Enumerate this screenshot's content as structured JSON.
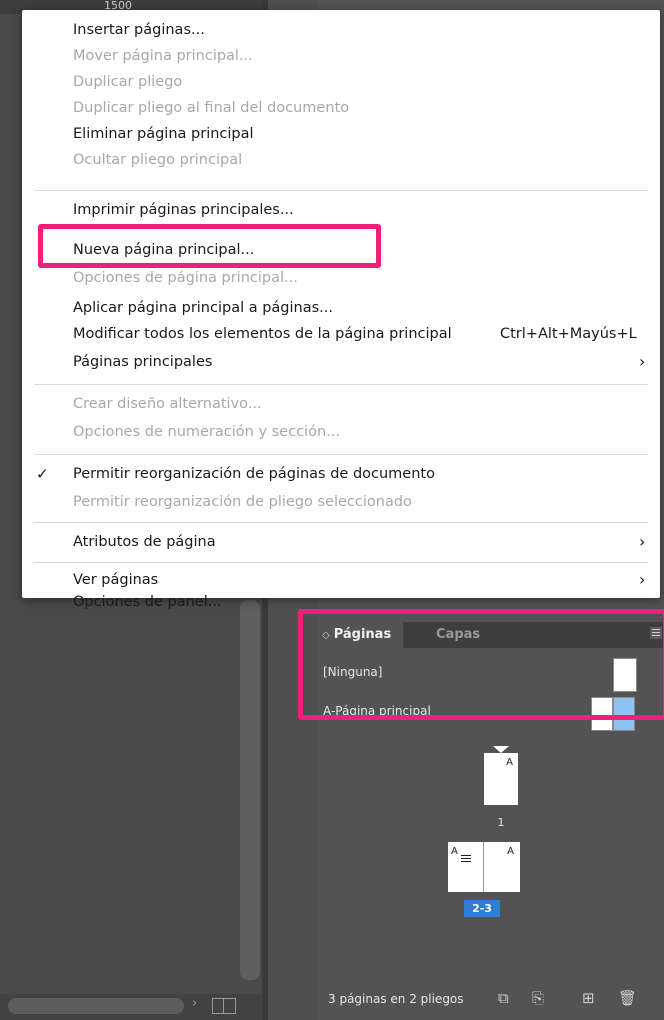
{
  "ruler": {
    "label": "1500"
  },
  "menu": {
    "items": [
      {
        "label": "Insertar páginas...",
        "enabled": true
      },
      {
        "label": "Mover página principal...",
        "enabled": false
      },
      {
        "label": "Duplicar pliego",
        "enabled": false
      },
      {
        "label": "Duplicar pliego al final del documento",
        "enabled": false
      },
      {
        "label": "Eliminar página principal",
        "enabled": true
      },
      {
        "label": "Ocultar pliego principal",
        "enabled": false
      },
      {
        "label": "Imprimir páginas principales...",
        "enabled": true
      },
      {
        "label": "Nueva página principal...",
        "enabled": true,
        "highlighted": true
      },
      {
        "label": "Opciones de página principal...",
        "enabled": false
      },
      {
        "label": "Aplicar página principal a páginas...",
        "enabled": true
      },
      {
        "label": "Modificar todos los elementos de la página principal",
        "enabled": true,
        "shortcut": "Ctrl+Alt+Mayús+L"
      },
      {
        "label": "Páginas principales",
        "enabled": true,
        "submenu": true
      },
      {
        "label": "Crear diseño alternativo...",
        "enabled": false
      },
      {
        "label": "Opciones de numeración y sección...",
        "enabled": false
      },
      {
        "label": "Permitir reorganización de páginas de documento",
        "enabled": true,
        "checked": true
      },
      {
        "label": "Permitir reorganización de pliego seleccionado",
        "enabled": false
      },
      {
        "label": "Atributos de página",
        "enabled": true,
        "submenu": true
      },
      {
        "label": "Ver páginas",
        "enabled": true,
        "submenu": true
      },
      {
        "label": "Opciones de panel...",
        "enabled": true
      }
    ],
    "check_glyph": "✓",
    "submenu_glyph": "›"
  },
  "panel": {
    "tabs": {
      "pages": "Páginas",
      "layers": "Capas"
    },
    "tab_arrow": "◇",
    "masters": [
      {
        "label": "[Ninguna]"
      },
      {
        "label": "A-Página principal"
      }
    ],
    "pages": {
      "page1_master": "A",
      "page1_number": "1",
      "spread_left_master": "A",
      "spread_right_master": "A",
      "spread_label": "2-3"
    },
    "status": "3 páginas en 2 pliegos",
    "footer_icons": [
      "edit-page-size-icon",
      "create-new-page-icon",
      "add-page-icon",
      "delete-page-icon"
    ]
  },
  "colors": {
    "highlight": "#ee207a",
    "selected_spread": "#2e7fd8",
    "master_selected": "#8fc1f1"
  }
}
